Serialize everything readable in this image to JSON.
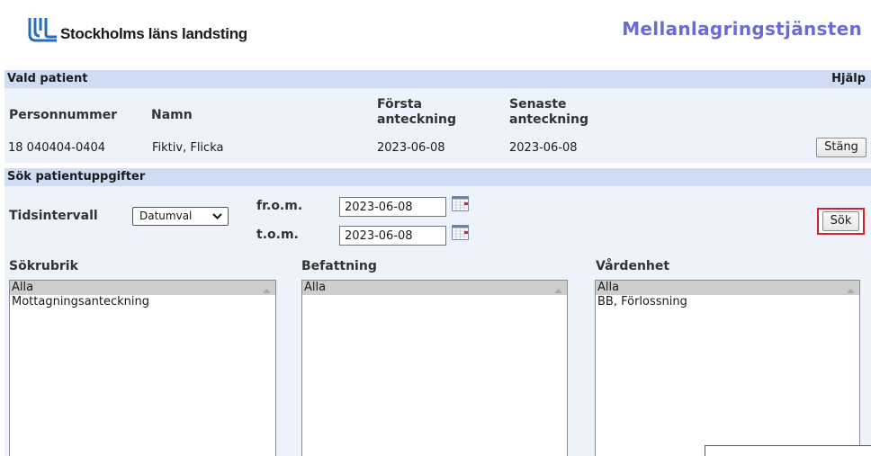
{
  "header": {
    "org_name": "Stockholms läns landsting",
    "app_title": "Mellanlagringstjänsten"
  },
  "patient_section": {
    "title": "Vald patient",
    "help_label": "Hjälp",
    "columns": [
      "Personnummer",
      "Namn",
      "Första anteckning",
      "Senaste anteckning"
    ],
    "columns_wrapped": {
      "forsta_1": "Första",
      "forsta_2": "anteckning",
      "senaste_1": "Senaste",
      "senaste_2": "anteckning"
    },
    "row": {
      "personnummer": "18 040404-0404",
      "namn": "Fiktiv, Flicka",
      "forsta": "2023-06-08",
      "senaste": "2023-06-08"
    },
    "close_label": "Stäng"
  },
  "search_section": {
    "title": "Sök patientuppgifter",
    "interval_label": "Tidsintervall",
    "interval_value": "Datumval",
    "from_label": "fr.o.m.",
    "from_value": "2023-06-08",
    "to_label": "t.o.m.",
    "to_value": "2023-06-08",
    "search_label": "Sök",
    "accent_color": "#d6202a"
  },
  "lists": {
    "sokrubrik": {
      "label": "Sökrubrik",
      "options": [
        "Alla",
        "Mottagningsanteckning"
      ],
      "selected": "Alla"
    },
    "befattning": {
      "label": "Befattning",
      "options": [
        "Alla"
      ],
      "selected": "Alla"
    },
    "vardenhet": {
      "label": "Vårdenhet",
      "options": [
        "Alla",
        "BB, Förlossning"
      ],
      "selected": "Alla"
    }
  },
  "colors": {
    "title": "#6d6bd0",
    "section_bar": "#cfdcf3",
    "panel": "#eef3fb",
    "selected_option": "#cdcdcd"
  }
}
